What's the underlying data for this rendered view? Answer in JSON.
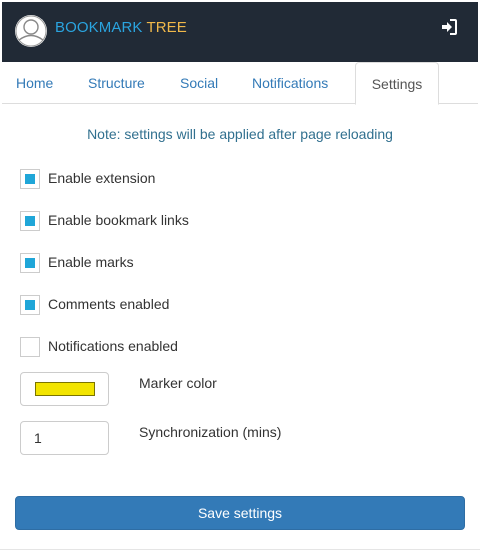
{
  "header": {
    "brand_part1": "BOOKMARK",
    "brand_part2": "TREE",
    "brand_color1": "#2aa4df",
    "brand_color2": "#f0b84a",
    "logo_icon": "avatar-logo-icon",
    "logout_icon": "sign-in-icon"
  },
  "tabs": [
    {
      "label": "Home",
      "active": false
    },
    {
      "label": "Structure",
      "active": false
    },
    {
      "label": "Social",
      "active": false
    },
    {
      "label": "Notifications",
      "active": false
    },
    {
      "label": "Settings",
      "active": true
    }
  ],
  "note": "Note: settings will be applied after page reloading",
  "checkboxes": [
    {
      "label": "Enable extension",
      "checked": true
    },
    {
      "label": "Enable bookmark links",
      "checked": true
    },
    {
      "label": "Enable marks",
      "checked": true
    },
    {
      "label": "Comments enabled",
      "checked": true
    },
    {
      "label": "Notifications enabled",
      "checked": false
    }
  ],
  "marker_color": {
    "label": "Marker color",
    "value": "#f2e400"
  },
  "synchronization": {
    "label": "Synchronization (mins)",
    "value": "1"
  },
  "save_label": "Save settings",
  "colors": {
    "accent": "#337ab7",
    "check": "#1fa6d8",
    "header_bg": "#212a36"
  }
}
